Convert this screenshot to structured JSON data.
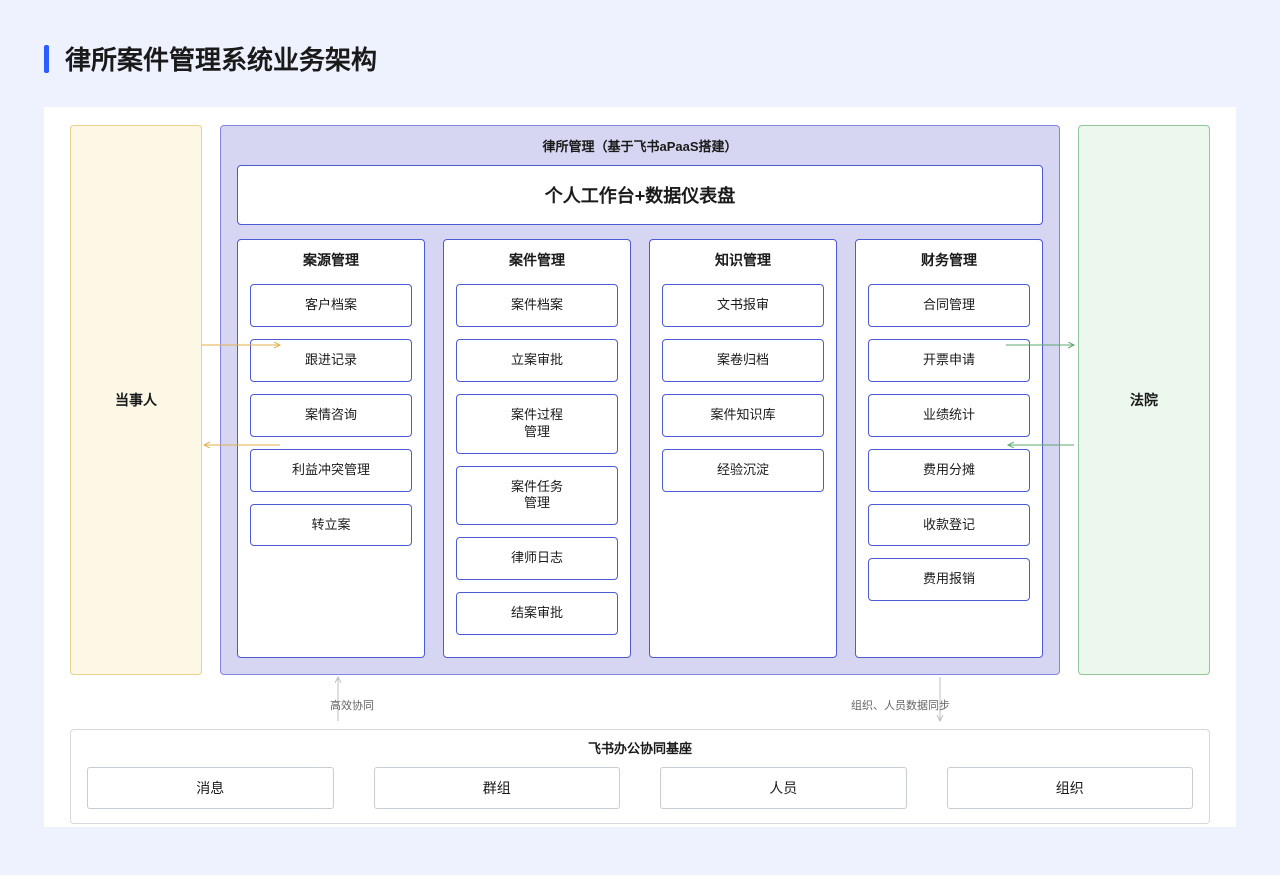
{
  "title": "律所案件管理系统业务架构",
  "left_entity": "当事人",
  "right_entity": "法院",
  "center": {
    "header": "律所管理（基于飞书aPaaS搭建）",
    "dashboard": "个人工作台+数据仪表盘",
    "columns": [
      {
        "title": "案源管理",
        "items": [
          "客户档案",
          "跟进记录",
          "案情咨询",
          "利益冲突管理",
          "转立案"
        ]
      },
      {
        "title": "案件管理",
        "items": [
          "案件档案",
          "立案审批",
          "案件过程\n管理",
          "案件任务\n管理",
          "律师日志",
          "结案审批"
        ]
      },
      {
        "title": "知识管理",
        "items": [
          "文书报审",
          "案卷归档",
          "案件知识库",
          "经验沉淀"
        ]
      },
      {
        "title": "财务管理",
        "items": [
          "合同管理",
          "开票申请",
          "业绩统计",
          "费用分摊",
          "收款登记",
          "费用报销"
        ]
      }
    ]
  },
  "bottom_labels": {
    "left": "高效协同",
    "right": "组织、人员数据同步"
  },
  "base": {
    "title": "飞书办公协同基座",
    "items": [
      "消息",
      "群组",
      "人员",
      "组织"
    ]
  }
}
